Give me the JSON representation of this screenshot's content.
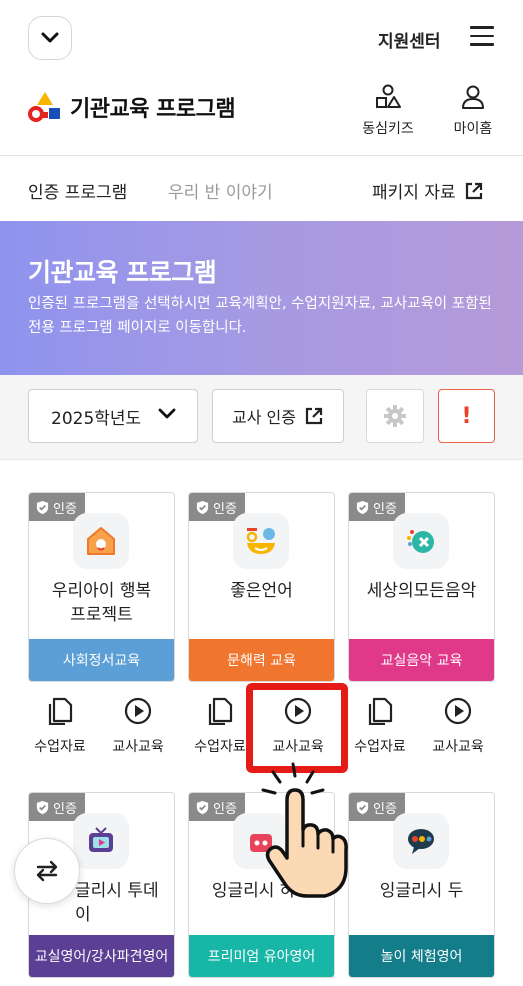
{
  "header": {
    "support_label": "지원센터",
    "brand_title": "기관교육 프로그램",
    "nav": [
      {
        "label": "동심키즈",
        "icon": "shapes-icon"
      },
      {
        "label": "마이홈",
        "icon": "person-icon"
      }
    ]
  },
  "tabs": {
    "active": "인증 프로그램",
    "inactive": "우리 반 이야기",
    "package": "패키지 자료"
  },
  "banner": {
    "title": "기관교육 프로그램",
    "description": "인증된 프로그램을 선택하시면 교육계획안, 수업지원자료, 교사교육이 포함된 전용 프로그램 페이지로 이동합니다."
  },
  "filters": {
    "year": "2025학년도",
    "teacher_cert": "교사 인증",
    "alert": "!"
  },
  "badge_label": "인증",
  "actions": {
    "material": "수업자료",
    "teacher_edu": "교사교육"
  },
  "programs_row1": [
    {
      "name": "우리아이 행복프로젝트",
      "category": "사회정서교육",
      "color": "#5b9fd6"
    },
    {
      "name": "좋은언어",
      "category": "문해력 교육",
      "color": "#f0762f"
    },
    {
      "name": "세상의모든음악",
      "category": "교실음악 교육",
      "color": "#e0398a"
    }
  ],
  "programs_row2": [
    {
      "name": "잉글리시 투데이",
      "visible_name": "글리시 투데이",
      "category": "교실영어/강사파견영어",
      "color": "#5b3f95"
    },
    {
      "name": "잉글리시 하이",
      "category": "프리미엄 유아영어",
      "color": "#18b6a6"
    },
    {
      "name": "잉글리시 두",
      "category": "놀이 체험영어",
      "color": "#137d8a"
    }
  ]
}
